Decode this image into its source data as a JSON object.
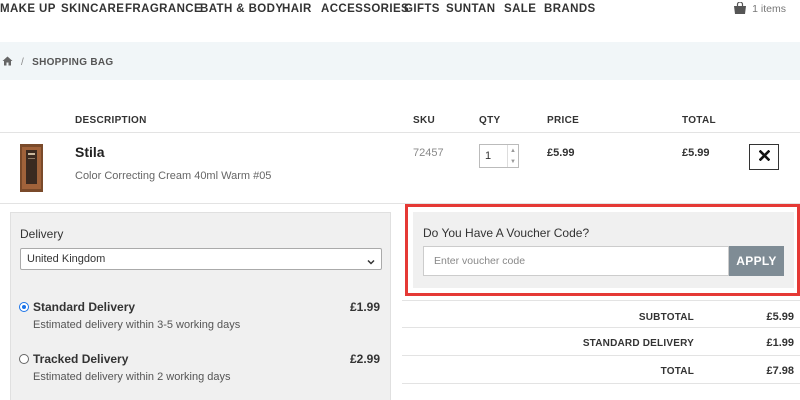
{
  "nav": {
    "items": [
      "MAKE UP",
      "SKINCARE",
      "FRAGRANCE",
      "BATH & BODY",
      "HAIR",
      "ACCESSORIES",
      "GIFTS",
      "SUNTAN",
      "SALE",
      "BRANDS"
    ],
    "bag_count": "1 items"
  },
  "breadcrumb": {
    "home_icon": "home-icon",
    "separator": "/",
    "current": "SHOPPING BAG"
  },
  "table": {
    "headers": {
      "description": "DESCRIPTION",
      "sku": "SKU",
      "qty": "QTY",
      "price": "PRICE",
      "total": "TOTAL"
    }
  },
  "product": {
    "name": "Stila",
    "description": "Color Correcting Cream 40ml Warm #05",
    "sku": "72457",
    "qty": "1",
    "price": "£5.99",
    "total": "£5.99",
    "remove_icon": "close-icon"
  },
  "delivery": {
    "label": "Delivery",
    "country": "United Kingdom",
    "options": [
      {
        "title": "Standard Delivery",
        "desc": "Estimated delivery within 3-5 working days",
        "price": "£1.99",
        "selected": true
      },
      {
        "title": "Tracked Delivery",
        "desc": "Estimated delivery within 2 working days",
        "price": "£2.99",
        "selected": false
      }
    ]
  },
  "voucher": {
    "title": "Do You Have A Voucher Code?",
    "placeholder": "Enter voucher code",
    "apply_label": "APPLY"
  },
  "summary": {
    "subtotal_label": "SUBTOTAL",
    "subtotal": "£5.99",
    "delivery_label": "STANDARD DELIVERY",
    "delivery": "£1.99",
    "total_label": "TOTAL",
    "total": "£7.98"
  },
  "colors": {
    "highlight": "#e53935",
    "apply_button": "#7f8c95",
    "breadcrumb_band": "#f1f6f8",
    "panel": "#f0f0f0"
  }
}
